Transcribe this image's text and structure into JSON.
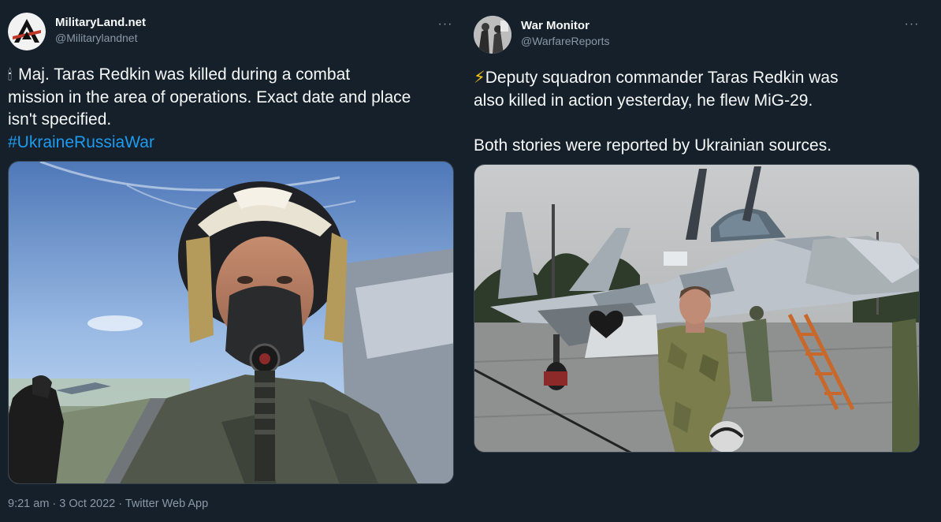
{
  "left_tweet": {
    "display_name": "MilitaryLand.net",
    "handle": "@Militarylandnet",
    "more_label": "···",
    "candle_emoji": "🕯",
    "text_line1": "Maj. Taras Redkin was killed during a combat",
    "text_line2": "mission in the area of operations. Exact date and place",
    "text_line3": "isn't specified.",
    "hashtag": "#UkraineRussiaWar",
    "time": "9:21 am",
    "separator": " · ",
    "date": "3 Oct 2022",
    "source": "Twitter Web App"
  },
  "right_tweet": {
    "display_name": "War Monitor",
    "handle": "@WarfareReports",
    "more_label": "···",
    "lightning_emoji": "⚡",
    "text_line1": "Deputy squadron commander Taras Redkin was",
    "text_line2": "also killed in action yesterday, he flew MiG-29.",
    "text_line3": "Both stories were reported by Ukrainian sources."
  },
  "colors": {
    "background": "#15202b",
    "text": "#f7f9f9",
    "secondary_text": "#8b98a5",
    "link": "#1d9bf0",
    "border": "#38444d"
  },
  "icons": [
    "more-icon",
    "candle-icon",
    "lightning-icon",
    "black-heart-icon"
  ]
}
